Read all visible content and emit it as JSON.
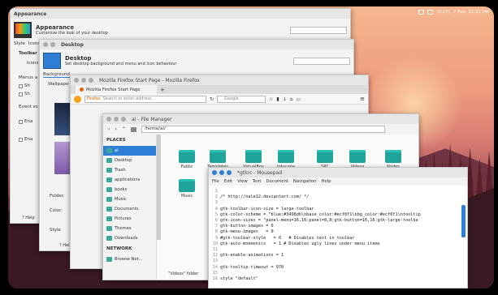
{
  "tray": {
    "battery": "(2:27)",
    "time": "7 Feb, 21:31 PM",
    "abbr": "1:31"
  },
  "appearance": {
    "title": "Appearance",
    "heading": "Appearance",
    "sub": "Customize the look of your desktop",
    "tabs": [
      "Style",
      "Icons"
    ],
    "sec_toolbar": "Toolbar",
    "icons_label": "Icons",
    "menus": "Menus a",
    "show": [
      "Sh",
      "Sh"
    ],
    "event": "Event so",
    "en": [
      "Ena",
      "Ena"
    ],
    "help": "Help"
  },
  "desktop": {
    "title": "Desktop",
    "heading": "Desktop",
    "sub": "Set desktop background and menu and icon behaviour",
    "tab_bg": "Background",
    "wallpaper": "Wallpapo",
    "folder": "Folder:",
    "color": "Color:",
    "style": "Style",
    "help": "Help"
  },
  "firefox": {
    "title": "Mozilla Firefox Start Page - Mozilla Firefox",
    "tab": "Mozilla Firefox Start Page",
    "url_brand": "Firefox",
    "url_placeholder": "Search or enter address",
    "search_placeholder": "Google",
    "plus": "+"
  },
  "fm": {
    "title": "ai - File Manager",
    "path": "/home/ai/",
    "places_label": "PLACES",
    "network_label": "NETWORK",
    "places": [
      "ai",
      "Desktop",
      "Trash",
      "applications",
      "books",
      "Music",
      "Documents",
      "Pictures",
      "Themes",
      "Downloads"
    ],
    "network": [
      "Browse Net..."
    ],
    "folders": [
      "Public",
      "Templates",
      "VirtualBox VMs",
      "inkscape",
      "SRC",
      "Videos",
      "Nodes",
      "Music"
    ],
    "status": "\"Videos\" folder"
  },
  "mousepad": {
    "title": "*gtkrc - Mousepad",
    "menu": [
      "File",
      "Edit",
      "View",
      "Text",
      "Document",
      "Navigation",
      "Help"
    ],
    "lines": [
      {
        "n": "1",
        "t": ""
      },
      {
        "n": "2",
        "t": "/* http://nale12.deviantart.com/ */"
      },
      {
        "n": "3",
        "t": ""
      },
      {
        "n": "4",
        "t": "gtk-toolbar-icon-size = large-toolbar"
      },
      {
        "n": "5",
        "t": "gtk-color-scheme = \"blue:#3498db\\nbase_color:#ecf0f1\\nbg_color:#ecf0f1\\ntooltip"
      },
      {
        "n": "6",
        "t": "gtk-icon-sizes = \"panel-menu=16,16:panel=8,8:gtk-button=16,16:gtk-large-toolba"
      },
      {
        "n": "7",
        "t": "gtk-button-images = 0"
      },
      {
        "n": "8",
        "t": "gtk-menu-images   = 0"
      },
      {
        "n": "9",
        "t": "#gtk-toolbar-style   = 0   # Disables text in toolbar"
      },
      {
        "n": "10",
        "t": "gtk-auto-mnemonics   = 1 # Disables ugly lines under menu items"
      },
      {
        "n": "11",
        "t": ""
      },
      {
        "n": "12",
        "t": "gtk-enable-animations = 1"
      },
      {
        "n": "13",
        "t": ""
      },
      {
        "n": "14",
        "t": "gtk-tooltip-timeout = 970"
      },
      {
        "n": "15",
        "t": ""
      },
      {
        "n": "16",
        "t": "style \"default\""
      }
    ]
  },
  "colors": {
    "accent": "#2f7fd6",
    "folder": "#1fa39a"
  }
}
